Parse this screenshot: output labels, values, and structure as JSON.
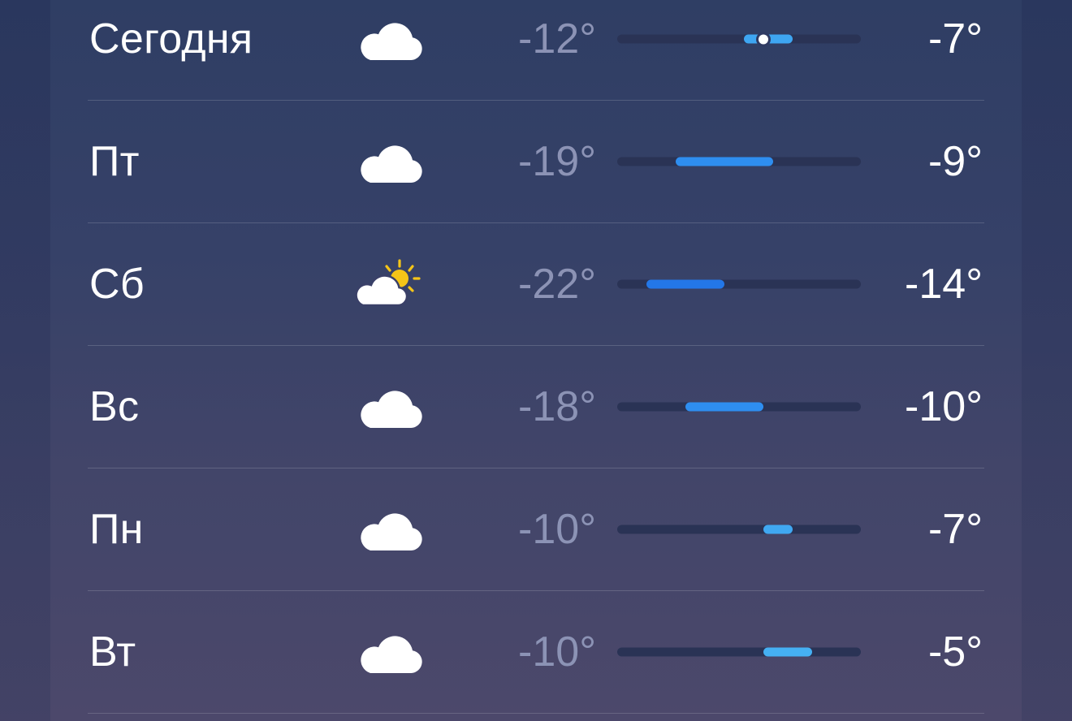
{
  "scale": {
    "min": -25,
    "max": 0
  },
  "current_temp": -10,
  "days": [
    {
      "day": "Сегодня",
      "icon": "cloud-icon",
      "low": "-12°",
      "high": "-7°",
      "low_value": -12,
      "high_value": -7,
      "fill_color": "#3ea6f2",
      "show_current": true
    },
    {
      "day": "Пт",
      "icon": "cloud-icon",
      "low": "-19°",
      "high": "-9°",
      "low_value": -19,
      "high_value": -9,
      "fill_color": "#2e8ef0",
      "show_current": false
    },
    {
      "day": "Сб",
      "icon": "partly-sunny-icon",
      "low": "-22°",
      "high": "-14°",
      "low_value": -22,
      "high_value": -14,
      "fill_color": "#2377e8",
      "show_current": false
    },
    {
      "day": "Вс",
      "icon": "cloud-icon",
      "low": "-18°",
      "high": "-10°",
      "low_value": -18,
      "high_value": -10,
      "fill_color": "#2e8ef0",
      "show_current": false
    },
    {
      "day": "Пн",
      "icon": "cloud-icon",
      "low": "-10°",
      "high": "-7°",
      "low_value": -10,
      "high_value": -7,
      "fill_color": "#40a8f2",
      "show_current": false
    },
    {
      "day": "Вт",
      "icon": "cloud-icon",
      "low": "-10°",
      "high": "-5°",
      "low_value": -10,
      "high_value": -5,
      "fill_color": "#45b0f3",
      "show_current": false
    }
  ]
}
